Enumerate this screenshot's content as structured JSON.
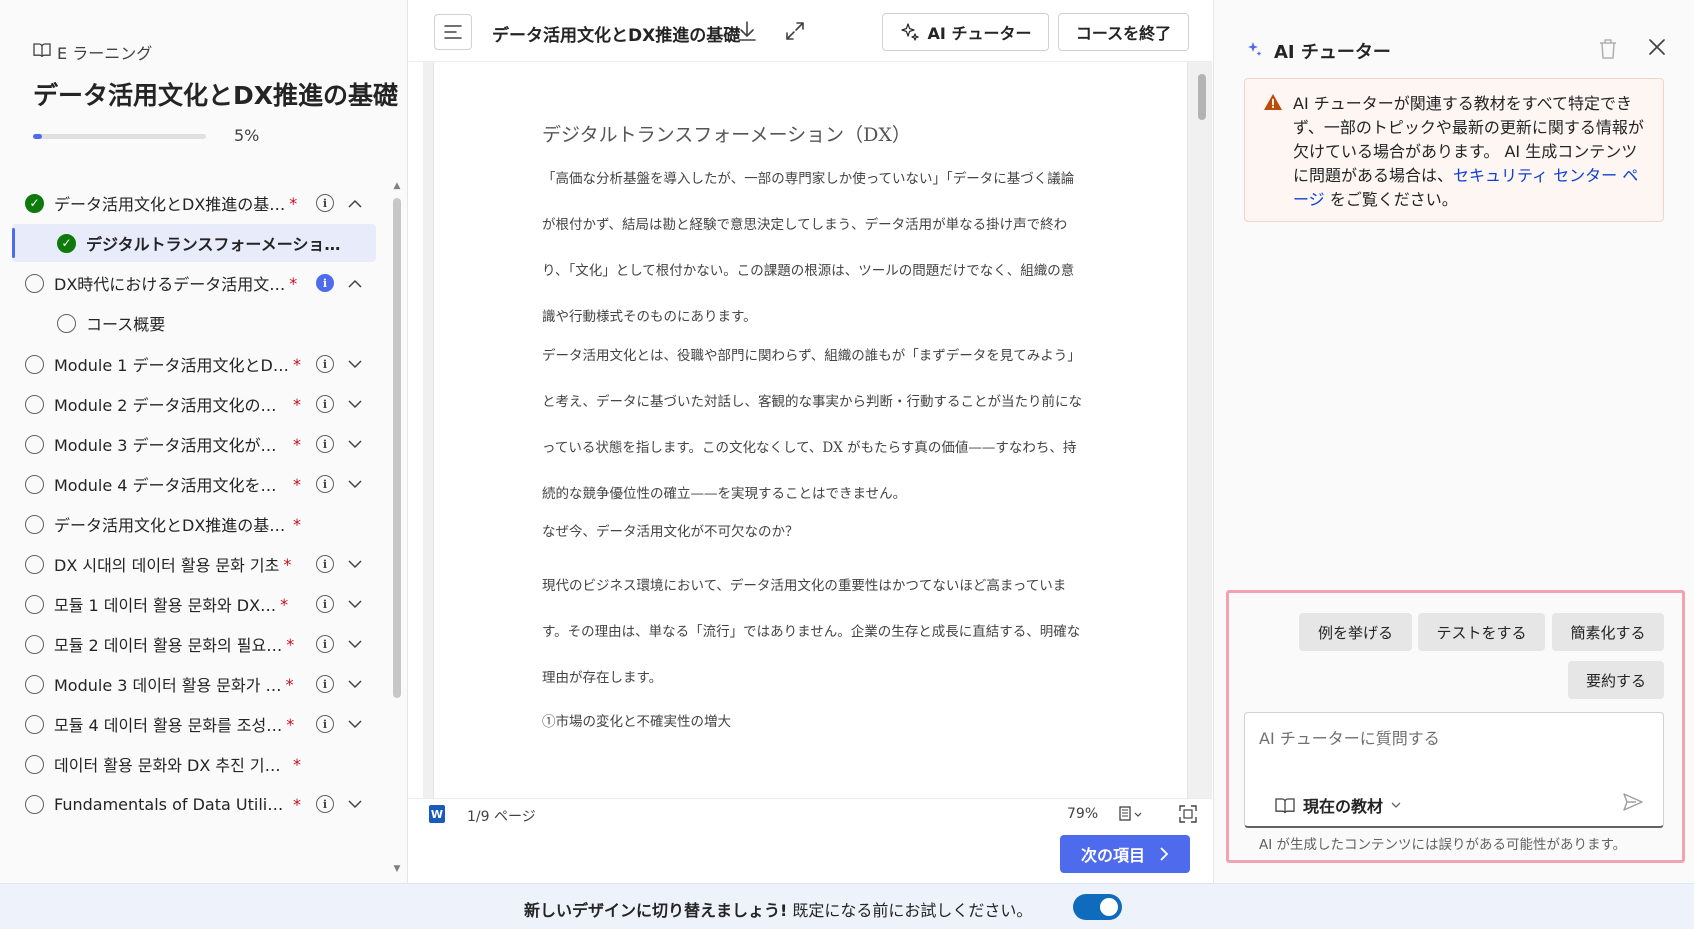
{
  "sidebar": {
    "crumb": "E ラーニング",
    "course_title": "データ活用文化とDX推進の基礎",
    "progress_percent": 5,
    "progress_text": "5%",
    "items": [
      {
        "label": "データ活用文化とDX推進の基…",
        "status": "done",
        "required": "*",
        "info": true,
        "chevron": "up"
      },
      {
        "label": "デジタルトランスフォーメーショ…",
        "status": "done",
        "child": true,
        "active": true
      },
      {
        "label": "DX時代におけるデータ活用文…",
        "status": "todo",
        "required": "*",
        "info": "filled",
        "chevron": "up"
      },
      {
        "label": "コース概要",
        "status": "todo",
        "child": true
      },
      {
        "label": "Module 1 データ活用文化とDX…",
        "status": "todo",
        "required": "*",
        "info": true,
        "chevron": "down"
      },
      {
        "label": "Module 2 データ活用文化の必…",
        "status": "todo",
        "required": "*",
        "info": true,
        "chevron": "down"
      },
      {
        "label": "Module 3 データ活用文化が根…",
        "status": "todo",
        "required": "*",
        "info": true,
        "chevron": "down"
      },
      {
        "label": "Module 4 データ活用文化を醸…",
        "status": "todo",
        "required": "*",
        "info": true,
        "chevron": "down"
      },
      {
        "label": "データ活用文化とDX推進の基礎クイズ",
        "status": "todo",
        "required": "*"
      },
      {
        "label": "DX 시대의 데이터 활용 문화 기초",
        "status": "todo",
        "required": "*",
        "info": true,
        "chevron": "down"
      },
      {
        "label": "모듈 1 데이터 활용 문화와 DX…",
        "status": "todo",
        "required": "*",
        "info": true,
        "chevron": "down"
      },
      {
        "label": "모듈 2 데이터 활용 문화의 필요…",
        "status": "todo",
        "required": "*",
        "info": true,
        "chevron": "down"
      },
      {
        "label": "Module 3 데이터 활용 문화가 …",
        "status": "todo",
        "required": "*",
        "info": true,
        "chevron": "down"
      },
      {
        "label": "모듈 4 데이터 활용 문화를 조성…",
        "status": "todo",
        "required": "*",
        "info": true,
        "chevron": "down"
      },
      {
        "label": "데이터 활용 문화와 DX 추진 기초 퀴즈",
        "status": "todo",
        "required": "*"
      },
      {
        "label": "Fundamentals of Data Utilizatio…",
        "status": "todo",
        "required": "*",
        "info": true,
        "chevron": "down"
      }
    ]
  },
  "toolbar": {
    "doc_title": "データ活用文化とDX推進の基礎",
    "ai_tutor_label": "AI チューター",
    "end_course_label": "コースを終了"
  },
  "document": {
    "heading": "デジタルトランスフォーメーション（DX）",
    "paragraphs": [
      "「高価な分析基盤を導入したが、一部の専門家しか使っていない」「データに基づく議論が根付かず、結局は勘と経験で意思決定してしまう、データ活用が単なる掛け声で終わり、「文化」として根付かない。この課題の根源は、ツールの問題だけでなく、組織の意識や行動様式そのものにあります。",
      "データ活用文化とは、役職や部門に関わらず、組織の誰もが「まずデータを見てみよう」と考え、データに基づいた対話し、客観的な事実から判断・行動することが当たり前になっている状態を指します。この文化なくして、DX がもたらす真の価値——すなわち、持続的な競争優位性の確立——を実現することはできません。",
      "なぜ今、データ活用文化が不可欠なのか？",
      "現代のビジネス環境において、データ活用文化の重要性はかつてないほど高まっています。その理由は、単なる「流行」ではありません。企業の生存と成長に直結する、明確な理由が存在します。",
      "①市場の変化と不確実性の増大"
    ]
  },
  "status_bar": {
    "page_text": "1/9 ページ",
    "zoom_text": "79%"
  },
  "next_button_label": "次の項目",
  "ai_panel": {
    "title": "AI チューター",
    "warning_text": "AI チューターが関連する教材をすべて特定できず、一部のトピックや最新の更新に関する情報が欠けている場合があります。 AI 生成コンテンツに問題がある場合は、",
    "warning_link": "セキュリティ センター ページ",
    "warning_suffix": " をご覧ください。",
    "chips": [
      "例を挙げる",
      "テストをする",
      "簡素化する",
      "要約する"
    ],
    "ask_placeholder": "AI チューターに質問する",
    "material_label": "現在の教材",
    "disclaimer": "AI が生成したコンテンツには誤りがある可能性があります。"
  },
  "banner": {
    "bold_text": "新しいデザインに切り替えましょう!",
    "text": " 既定になる前にお試しください。",
    "toggle_on": true
  },
  "colors": {
    "accent": "#4f6bed",
    "success": "#0e7a0b",
    "required": "#c50f1f",
    "warning_bg": "#fdf6f3",
    "highlight_border": "#f2a3b1"
  }
}
